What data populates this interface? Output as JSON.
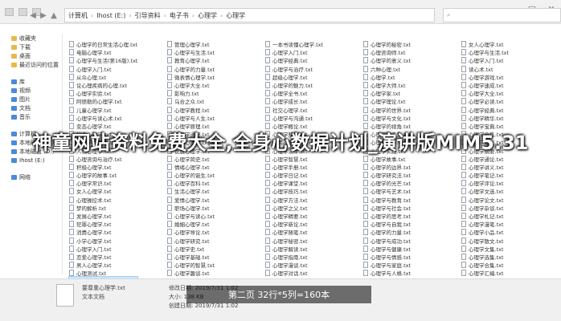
{
  "address": {
    "crumbs": [
      "计算机",
      "Ihost (E:)",
      "引导资料",
      "电子书",
      "心理学",
      "心理学"
    ],
    "search_placeholder": ""
  },
  "window_controls": {
    "minimize": "—",
    "maximize": "□",
    "close": "✕"
  },
  "nav": {
    "items": [
      {
        "label": "收藏夹",
        "kind": "star"
      },
      {
        "label": "下载",
        "kind": "folder"
      },
      {
        "label": "桌面",
        "kind": "folder"
      },
      {
        "label": "最近访问的位置",
        "kind": "folder"
      },
      {
        "label": "库",
        "kind": "lib"
      },
      {
        "label": "视频",
        "kind": "lib"
      },
      {
        "label": "图片",
        "kind": "lib"
      },
      {
        "label": "文档",
        "kind": "lib"
      },
      {
        "label": "音乐",
        "kind": "lib"
      },
      {
        "label": "计算机",
        "kind": "lib"
      },
      {
        "label": "本地磁盘 (C:)",
        "kind": "lib"
      },
      {
        "label": "本地磁盘 (D:)",
        "kind": "lib"
      },
      {
        "label": "Ihost (E:)",
        "kind": "lib"
      },
      {
        "label": "网络",
        "kind": "lib"
      }
    ]
  },
  "files": {
    "col1": [
      "心理学的日常生活心理.txt",
      "电脑心理学.txt",
      "心理学与生活(第16版).txt",
      "心理学入门.txt",
      "从众心理.txt",
      "论心理疾病的心理.txt",
      "心理学实验.txt",
      "阿德勒的心理学.txt",
      "儿童心理学.txt",
      "心理学与读心术.txt",
      "变态心理学.txt",
      "社会心理学.txt",
      "心理学的原理.txt",
      "人格心理学.txt",
      "心理咨询与治疗.txt",
      "积极心理学.txt",
      "心理学的故事.txt",
      "心理学常识.txt",
      "女人心理学.txt",
      "心理操控术.txt",
      "梦的解析.txt",
      "发展心理学.txt",
      "犯罪心理学.txt",
      "消费心理学.txt",
      "小学心理学.txt",
      "心理学入门.txt",
      "恋爱心理学.txt",
      "男人心理学.txt",
      "心理测试.txt",
      "行为心理学.txt"
    ],
    "col2": [
      "管理心理学.txt",
      "心理学与生活.txt",
      "教育心理学.txt",
      "心理学的力量.txt",
      "微表情心理学.txt",
      "心理学大全.txt",
      "影响力.txt",
      "乌合之众.txt",
      "心理学教程.txt",
      "心理学与人生.txt",
      "心理学原理.txt",
      "心理学通识.txt",
      "认知心理学.txt",
      "说服心理学.txt",
      "心理学简史.txt",
      "情绪心理学.txt",
      "心理学的诞生.txt",
      "心理学百科.txt",
      "生活心理学.txt",
      "爱情心理学.txt",
      "职场心理学.txt",
      "心理学与读心.txt",
      "婚姻心理学.txt",
      "心理学导论.txt",
      "心理学研究.txt",
      "心理学史.txt",
      "心理学基础.txt",
      "心理学的智慧.txt",
      "心理学趣谈.txt",
      "心理学入门.txt"
    ],
    "col3": [
      "一本书读懂心理学.txt",
      "心理学入门.txt",
      "心理学经典.txt",
      "心理学与治疗.txt",
      "超级心理学.txt",
      "心理学的魅力.txt",
      "心理学全书.txt",
      "心理学成长.txt",
      "社交心理学.txt",
      "心理学与沟通.txt",
      "心理学概论.txt",
      "心理学知识.txt",
      "实用心理学.txt",
      "心理学读本.txt",
      "心理学智慧.txt",
      "心理学手册.txt",
      "心理学日记.txt",
      "心理学课堂.txt",
      "心理学技巧.txt",
      "心理学方法.txt",
      "心理学之父.txt",
      "心理学精要.txt",
      "心理学新论.txt",
      "心理学随笔.txt",
      "心理学秘密.txt",
      "心理学解读.txt",
      "心理学指南.txt",
      "心理学漫谈.txt",
      "心理学对话.txt",
      "心理学问答.txt"
    ],
    "col4": [
      "心理学的秘密.txt",
      "心理咨询师.txt",
      "心理学的意义.txt",
      "六种心理.txt",
      "心理学.txt",
      "心理学大师.txt",
      "心理学家.txt",
      "心理学理论.txt",
      "心理学的世界.txt",
      "心理学与文化.txt",
      "心理学的视角.txt",
      "心理学的未来.txt",
      "心理学观察.txt",
      "心理学实践.txt",
      "心理学故事.txt",
      "心理学的边界.txt",
      "心理学研究法.txt",
      "心理学的光芒.txt",
      "心理学与艺术.txt",
      "心理学与教育.txt",
      "心理学与社会.txt",
      "心理学的思考.txt",
      "心理学与自我.txt",
      "心理学的力量.txt",
      "心理学与成功.txt",
      "心理学与健康.txt",
      "心理学与情感.txt",
      "心理学与家庭.txt",
      "心理学与人格.txt",
      "心理学与行为.txt"
    ],
    "col5": [
      "女人心理学.txt",
      "心理学与生活.txt",
      "心理学入门.txt",
      "读心术.txt",
      "心理学游戏.txt",
      "心理学速成.txt",
      "心理学大全.txt",
      "心理学必读.txt",
      "心理学经典.txt",
      "心理学精华.txt",
      "心理学宝典.txt",
      "心理学全集.txt",
      "心理学要义.txt",
      "心理学纲要.txt",
      "心理学通论.txt",
      "心理学讲义.txt",
      "心理学笔记.txt",
      "心理学评论.txt",
      "心理学文选.txt",
      "心理学论文.txt",
      "心理学杂谈.txt",
      "心理学札记.txt",
      "心理学漫笔.txt",
      "心理学小品.txt",
      "心理学散文.txt",
      "心理学文集.txt",
      "心理学选集.txt",
      "心理学合集.txt",
      "心理学汇编.txt",
      "心理学辑录.txt"
    ]
  },
  "status": {
    "selected_name": "要尊重心理学.txt",
    "type_label": "文本文档",
    "modified": "修改日期: 2019/7/31 1:02",
    "size": "大小: 138 KB",
    "created": "创建日期: 2019/7/31 1:02"
  },
  "overlay": {
    "title": "神童网站资料免费大全,全身心数据计划_演讲版MIM5.31",
    "page_info": "第二页 32行*5列=160本"
  }
}
